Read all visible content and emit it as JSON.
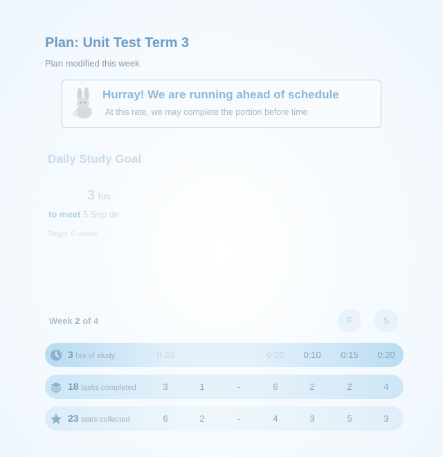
{
  "plan": {
    "title": "Plan: Unit Test Term 3",
    "subtitle": "Plan modified this week"
  },
  "banner": {
    "title": "Hurray! We are running ahead of schedule",
    "subtitle": "At this rate, we may complete the portion before time",
    "icon": "bunny-icon"
  },
  "goal": {
    "title": "Daily Study Goal",
    "hours": "3",
    "hours_unit": "hrs",
    "meet_prefix": "to meet",
    "meet_date": "5 Sep de",
    "target": "Target: 5 chapte"
  },
  "week": {
    "label_prefix": "Week",
    "current": "2",
    "label_suffix": "of 4",
    "days": [
      "F",
      "S"
    ]
  },
  "rows": [
    {
      "icon": "clock-icon",
      "count": "3",
      "label": "hrs of study",
      "values": [
        "0:20",
        "",
        "",
        "0:20",
        "0:10",
        "0:15",
        "0:20"
      ]
    },
    {
      "icon": "layers-icon",
      "count": "18",
      "label": "tasks completed",
      "values": [
        "3",
        "1",
        "-",
        "6",
        "2",
        "2",
        "4"
      ]
    },
    {
      "icon": "star-icon",
      "count": "23",
      "label": "stars collected",
      "values": [
        "6",
        "2",
        "-",
        "4",
        "3",
        "5",
        "3"
      ]
    }
  ],
  "colors": {
    "accent": "#6e9cc4",
    "banner_border": "#b6d3e8",
    "row_highlight": "#b7dbf2"
  }
}
